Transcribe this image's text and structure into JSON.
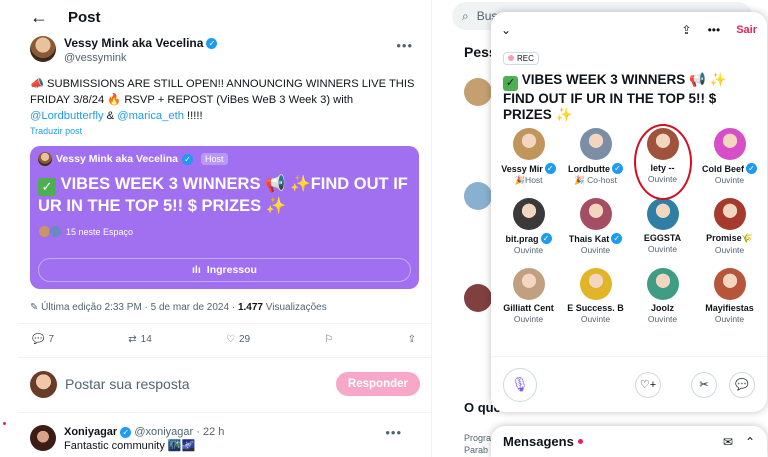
{
  "header": {
    "back_icon": "←",
    "title": "Post"
  },
  "post": {
    "author_name": "Vessy Mink aka Vecelina",
    "author_handle": "@vessymink",
    "text_before": "📣 SUBMISSIONS ARE STILL OPEN!! ANNOUNCING WINNERS LIVE THIS FRIDAY 3/8/24 🔥 RSVP + REPOST (ViBes WeB 3 Week 3) with ",
    "mention1": "@Lordbutterfly",
    "amp": " & ",
    "mention2": "@marica_eth",
    "text_after": " !!!!!",
    "translate": "Traduzir post",
    "space": {
      "host_name": "Vessy Mink aka Vecelina",
      "host_badge": "Host",
      "title": "VIBES WEEK 3 WINNERS 📢 ✨FIND OUT IF UR IN THE TOP 5!! $ PRIZES ✨",
      "listeners": "15 neste Espaço",
      "joined_label": "Ingressou"
    },
    "edited_prefix": "Última edição 2:33 PM · 5 de mar de 2024 · ",
    "views_count": "1.477",
    "views_label": " Visualizações",
    "stats": {
      "replies": "7",
      "reposts": "14",
      "likes": "29"
    }
  },
  "reply_box": {
    "placeholder": "Postar sua resposta",
    "button": "Responder"
  },
  "comment": {
    "name": "Xoniyagar",
    "handle": "@xoniyagar",
    "time": "· 22 h",
    "text": "Fantastic community 🌃🌌"
  },
  "right": {
    "search_placeholder": "Buscar",
    "section_people": "Pess",
    "section_trends": "O que está acontecendo",
    "trend_line1": "Progra",
    "trend_line2": "Parab"
  },
  "space_popup": {
    "leave_label": "Sair",
    "rec_label": "REC",
    "title": "VIBES WEEK 3 WINNERS 📢 ✨ FIND OUT IF UR IN THE TOP 5!! $ PRIZES ✨",
    "participants": [
      {
        "name": "Vessy Mir",
        "role": "🎉Host",
        "verified": true,
        "color": "#c2955c"
      },
      {
        "name": "Lordbutte",
        "role": "🎉 Co-host",
        "verified": true,
        "color": "#7a8fa6"
      },
      {
        "name": "lety --",
        "role": "Ouvinte",
        "verified": false,
        "color": "#a0523c"
      },
      {
        "name": "Cold Beef",
        "role": "Ouvinte",
        "verified": true,
        "color": "#d64fc8"
      },
      {
        "name": "bit.prag",
        "role": "Ouvinte",
        "verified": true,
        "color": "#3a3a3a"
      },
      {
        "name": "Thais Kat",
        "role": "Ouvinte",
        "verified": true,
        "color": "#a44e64"
      },
      {
        "name": "EGGSTA",
        "role": "Ouvinte",
        "verified": false,
        "color": "#2e7fa3"
      },
      {
        "name": "Promise🌾",
        "role": "Ouvinte",
        "verified": false,
        "color": "#a63a2c"
      },
      {
        "name": "Gilliatt Cent",
        "role": "Ouvinte",
        "verified": false,
        "color": "#c0a080"
      },
      {
        "name": "E Success. B",
        "role": "Ouvinte",
        "verified": false,
        "color": "#e2b428"
      },
      {
        "name": "Joolz",
        "role": "Ouvinte",
        "verified": false,
        "color": "#3f9d86"
      },
      {
        "name": "Mayifiestas",
        "role": "Ouvinte",
        "verified": false,
        "color": "#b7553a"
      }
    ]
  },
  "messages": {
    "title": "Mensagens"
  }
}
